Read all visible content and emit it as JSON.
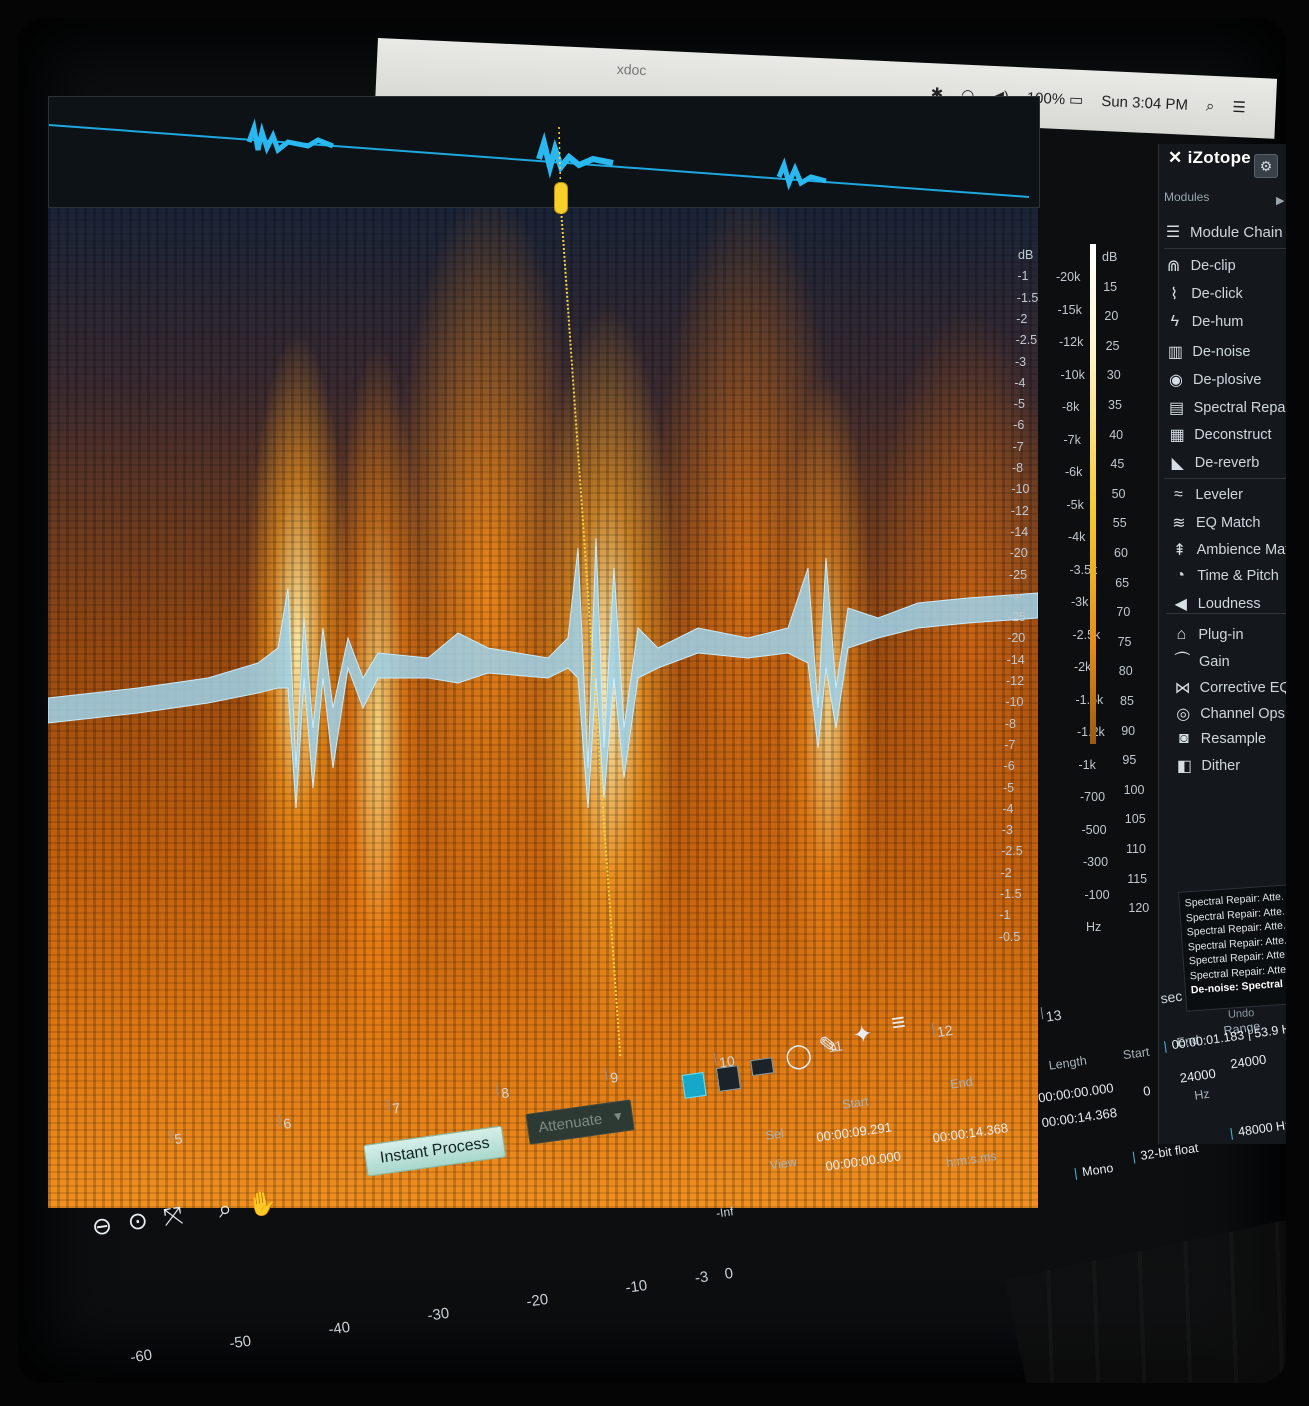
{
  "menubar": {
    "doc": "xdoc",
    "battery": "100%",
    "clock": "Sun 3:04 PM"
  },
  "app": {
    "brand": "iZotope",
    "modules_label": "Modules"
  },
  "modules": [
    {
      "label": "Module Chain",
      "icon": "list-icon"
    },
    {
      "label": "De-clip",
      "icon": "arch-icon"
    },
    {
      "label": "De-click",
      "icon": "click-wave-icon"
    },
    {
      "label": "De-hum",
      "icon": "lightning-icon"
    },
    {
      "label": "De-noise",
      "icon": "noise-icon"
    },
    {
      "label": "De-plosive",
      "icon": "lips-icon"
    },
    {
      "label": "Spectral Repair",
      "icon": "spectral-icon"
    },
    {
      "label": "Deconstruct",
      "icon": "grid-icon"
    },
    {
      "label": "De-reverb",
      "icon": "reverb-icon"
    },
    {
      "label": "Leveler",
      "icon": "leveler-icon"
    },
    {
      "label": "EQ Match",
      "icon": "eq-icon"
    },
    {
      "label": "Ambience Match",
      "icon": "tree-icon"
    },
    {
      "label": "Time & Pitch",
      "icon": "clock-icon"
    },
    {
      "label": "Loudness",
      "icon": "speaker-icon"
    },
    {
      "label": "Plug-in",
      "icon": "plug-icon"
    },
    {
      "label": "Gain",
      "icon": "gain-icon"
    },
    {
      "label": "Corrective EQ",
      "icon": "corrective-eq-icon"
    },
    {
      "label": "Channel Ops",
      "icon": "channel-ops-icon"
    },
    {
      "label": "Resample",
      "icon": "resample-icon"
    },
    {
      "label": "Dither",
      "icon": "dither-icon"
    }
  ],
  "history": {
    "items": [
      "Spectral Repair: Atte...",
      "Spectral Repair: Atte...",
      "Spectral Repair: Atte...",
      "Spectral Repair: Atte...",
      "Spectral Repair: Atte...",
      "Spectral Repair: Atte..."
    ],
    "current": "De-noise: Spectral",
    "undo_label": "Undo"
  },
  "db_scale": [
    "dB",
    "-1",
    "-1.5",
    "-2",
    "-2.5",
    "-3",
    "-4",
    "-5",
    "-6",
    "-7",
    "-8",
    "-10",
    "-12",
    "-14",
    "-20",
    "-25",
    "-∞",
    "-25",
    "-20",
    "-14",
    "-12",
    "-10",
    "-8",
    "-7",
    "-6",
    "-5",
    "-4",
    "-3",
    "-2.5",
    "-2",
    "-1.5",
    "-1",
    "-0.5"
  ],
  "hz_scale": [
    "-20k",
    "-15k",
    "-12k",
    "-10k",
    "-8k",
    "-7k",
    "-6k",
    "-5k",
    "-4k",
    "-3.5k",
    "-3k",
    "-2.5k",
    "-2k",
    "-1.5k",
    "-1.2k",
    "-1k",
    "-700",
    "-500",
    "-300",
    "-100",
    "Hz"
  ],
  "meter_scale": [
    "dB",
    "15",
    "20",
    "25",
    "30",
    "35",
    "40",
    "45",
    "50",
    "55",
    "60",
    "65",
    "70",
    "75",
    "80",
    "85",
    "90",
    "95",
    "100",
    "105",
    "110",
    "115",
    "120"
  ],
  "timeline": {
    "labels": [
      "5",
      "6",
      "7",
      "8",
      "9",
      "10",
      "11",
      "12",
      "13"
    ],
    "unit": "sec"
  },
  "toolbar": {
    "instant_process": "Instant Process",
    "mode": "Attenuate"
  },
  "selection": {
    "start_label": "Start",
    "end_label": "End",
    "length_label": "Length",
    "sel_label": "Sel",
    "view_label": "View",
    "sel_start": "00:00:09.291",
    "sel_end": "",
    "sel_length": "00:00:00.000",
    "view_start": "00:00:00.000",
    "view_end": "00:00:14.368",
    "view_length": "00:00:14.368",
    "time_format": "h:m:s.ms"
  },
  "freq": {
    "start_label": "Start",
    "end_label": "End",
    "range_label": "Range",
    "start": "0",
    "end": "24000",
    "range": "24000",
    "unit": "Hz"
  },
  "status": {
    "channels": "Mono",
    "bit_depth": "32-bit float",
    "sample_rate": "48000 Hz",
    "cursor": "00:00:01.183",
    "cursor_freq": "53.9 Hz"
  },
  "level_meter": {
    "labels": [
      "-60",
      "-50",
      "-40",
      "-30",
      "-20",
      "-10",
      "-3",
      "0"
    ],
    "inf": "-Inf"
  }
}
